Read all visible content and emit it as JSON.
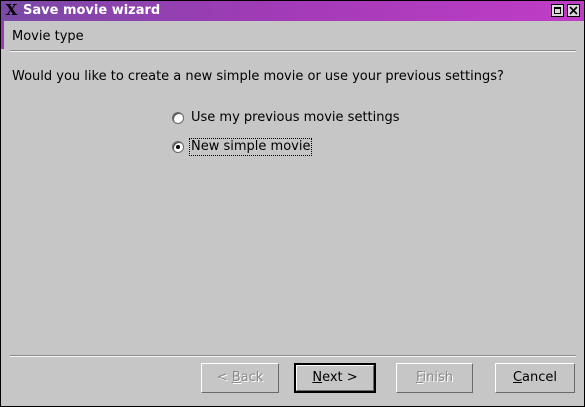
{
  "window": {
    "title": "Save movie wizard",
    "app_icon": "x-logo-icon",
    "controls": [
      "maximize-icon",
      "close-icon"
    ]
  },
  "header": {
    "label": "Movie type"
  },
  "content": {
    "question": "Would you like to create a new simple movie or use your previous settings?",
    "options": [
      {
        "label": "Use my previous movie settings",
        "checked": false
      },
      {
        "label": "New simple movie",
        "checked": true
      }
    ]
  },
  "buttons": {
    "back": {
      "prefix": "< ",
      "mnemonic": "B",
      "rest": "ack",
      "enabled": false
    },
    "next": {
      "prefix": "",
      "mnemonic": "N",
      "rest": "ext >",
      "enabled": true
    },
    "finish": {
      "prefix": "",
      "mnemonic": "F",
      "rest": "inish",
      "enabled": false
    },
    "cancel": {
      "prefix": "",
      "mnemonic": "C",
      "rest": "ancel",
      "enabled": true
    }
  },
  "colors": {
    "titlebar_start": "#7a4aa6",
    "titlebar_end": "#c03cc6",
    "background": "#c6c6c6"
  }
}
